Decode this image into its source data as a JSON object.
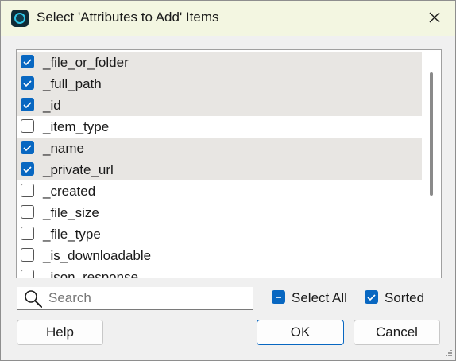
{
  "window": {
    "title": "Select 'Attributes to Add' Items"
  },
  "list": {
    "items": [
      {
        "label": "_file_or_folder",
        "checked": true
      },
      {
        "label": "_full_path",
        "checked": true
      },
      {
        "label": "_id",
        "checked": true
      },
      {
        "label": "_item_type",
        "checked": false
      },
      {
        "label": "_name",
        "checked": true
      },
      {
        "label": "_private_url",
        "checked": true
      },
      {
        "label": "_created",
        "checked": false
      },
      {
        "label": "_file_size",
        "checked": false
      },
      {
        "label": "_file_type",
        "checked": false
      },
      {
        "label": "_is_downloadable",
        "checked": false
      },
      {
        "label": "_json_response",
        "checked": false
      }
    ]
  },
  "search": {
    "placeholder": "Search",
    "value": ""
  },
  "options": {
    "select_all": {
      "label": "Select All",
      "state": "partial"
    },
    "sorted": {
      "label": "Sorted",
      "checked": true
    }
  },
  "buttons": {
    "help": "Help",
    "ok": "OK",
    "cancel": "Cancel"
  },
  "colors": {
    "accent": "#0867c1",
    "titlebar": "#f3f6e1",
    "selected_row": "#e8e6e3"
  },
  "icons": {
    "app": "app-icon",
    "close": "close-icon",
    "search": "search-icon",
    "check": "checkmark-icon",
    "grip": "resize-grip-icon"
  }
}
